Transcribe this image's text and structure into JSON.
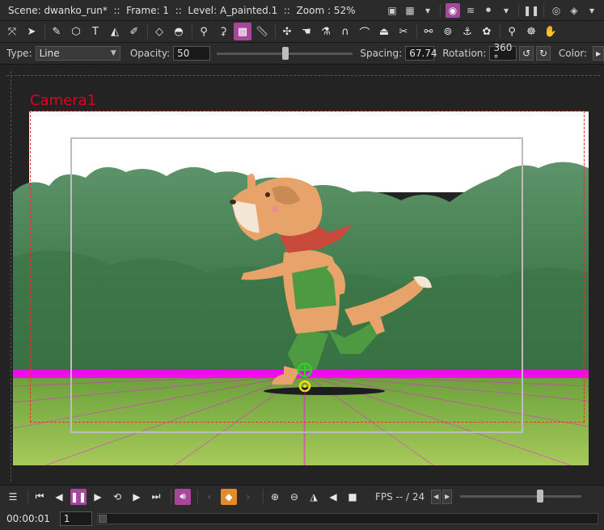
{
  "titlebar": {
    "title": "Scene: dwanko_run*  ::  Frame: 1  ::  Level: A_painted.1  ::  Zoom : 52%"
  },
  "options": {
    "type_label": "Type:",
    "type_value": "Line",
    "opacity_label": "Opacity:",
    "opacity_value": "50",
    "opacity_fraction": 0.5,
    "spacing_label": "Spacing:",
    "spacing_value": "67.74",
    "rotation_label": "Rotation:",
    "rotation_value": "360 °",
    "color_label": "Color:"
  },
  "viewer": {
    "camera_label": "Camera1"
  },
  "playback": {
    "fps_label": "FPS -- / 24",
    "zoom_slider_fraction": 0.67
  },
  "framebar": {
    "time": "00:00:01",
    "frame": "1"
  },
  "colors": {
    "accent": "#a6479c",
    "keyframe": "#e38a2a",
    "horizon": "#ff00ff",
    "camera": "#e0001b"
  }
}
